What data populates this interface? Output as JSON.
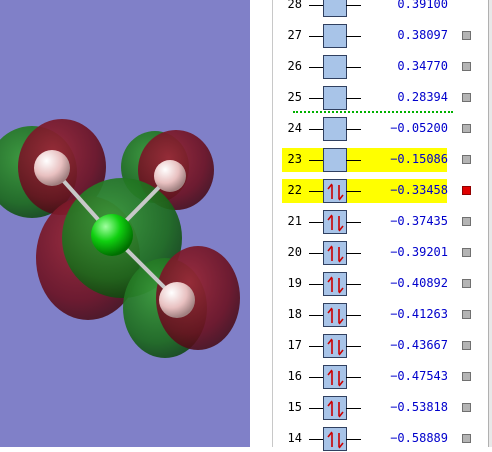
{
  "molecular_orbitals": [
    {
      "number": "28",
      "energy": "0.39100",
      "occupied": false,
      "highlighted": false,
      "selected": false
    },
    {
      "number": "27",
      "energy": "0.38097",
      "occupied": false,
      "highlighted": false,
      "selected": false
    },
    {
      "number": "26",
      "energy": "0.34770",
      "occupied": false,
      "highlighted": false,
      "selected": false
    },
    {
      "number": "25",
      "energy": "0.28394",
      "occupied": false,
      "highlighted": false,
      "selected": false
    },
    {
      "number": "24",
      "energy": "−0.05200",
      "occupied": false,
      "highlighted": false,
      "selected": false
    },
    {
      "number": "23",
      "energy": "−0.15086",
      "occupied": false,
      "highlighted": true,
      "selected": false
    },
    {
      "number": "22",
      "energy": "−0.33458",
      "occupied": true,
      "highlighted": true,
      "selected": true
    },
    {
      "number": "21",
      "energy": "−0.37435",
      "occupied": true,
      "highlighted": false,
      "selected": false
    },
    {
      "number": "20",
      "energy": "−0.39201",
      "occupied": true,
      "highlighted": false,
      "selected": false
    },
    {
      "number": "19",
      "energy": "−0.40892",
      "occupied": true,
      "highlighted": false,
      "selected": false
    },
    {
      "number": "18",
      "energy": "−0.41263",
      "occupied": true,
      "highlighted": false,
      "selected": false
    },
    {
      "number": "17",
      "energy": "−0.43667",
      "occupied": true,
      "highlighted": false,
      "selected": false
    },
    {
      "number": "16",
      "energy": "−0.47543",
      "occupied": true,
      "highlighted": false,
      "selected": false
    },
    {
      "number": "15",
      "energy": "−0.53818",
      "occupied": true,
      "highlighted": false,
      "selected": false
    },
    {
      "number": "14",
      "energy": "−0.58889",
      "occupied": true,
      "highlighted": false,
      "selected": false
    }
  ],
  "colors": {
    "viewer_background": "#8080c8",
    "highlight": "#ffff00",
    "energy_text": "#0000cc",
    "orbital_box": "#a8c4e8",
    "electron_arrow": "#cc0000",
    "selected_square": "#e00000",
    "unselected_square": "#b4b4b4",
    "homo_lumo_separator": "#00b000",
    "lobe_positive": "#1a6e1a",
    "lobe_negative": "#6e1020",
    "carbon_atom": "#00dd00",
    "hydrogen_atom": "#f0c8c8"
  }
}
